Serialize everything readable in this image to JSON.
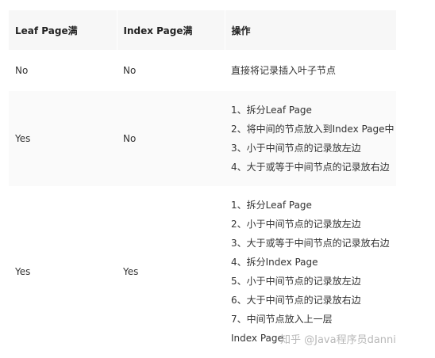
{
  "table": {
    "headers": [
      "Leaf Page满",
      "Index Page满",
      "操作"
    ],
    "rows": [
      {
        "leaf_full": "No",
        "index_full": "No",
        "ops": [
          "直接将记录插入叶子节点"
        ]
      },
      {
        "leaf_full": "Yes",
        "index_full": "No",
        "ops": [
          "1、拆分Leaf Page",
          "2、将中间的节点放入到Index Page中",
          "3、小于中间节点的记录放左边",
          "4、大于或等于中间节点的记录放右边"
        ]
      },
      {
        "leaf_full": "Yes",
        "index_full": "Yes",
        "ops": [
          "1、拆分Leaf Page",
          "2、小于中间节点的记录放左边",
          "3、大于或等于中间节点的记录放右边",
          "4、拆分Index Page",
          "5、小于中间节点的记录放左边",
          "6、大于中间节点的记录放右边",
          "7、中间节点放入上一层",
          "Index Page"
        ]
      }
    ]
  },
  "watermark": "知乎 @Java程序员danni"
}
